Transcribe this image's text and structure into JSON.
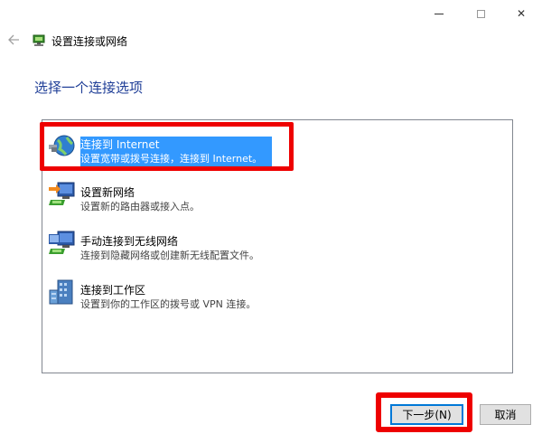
{
  "window": {
    "title": "设置连接或网络",
    "caption_close": "✕"
  },
  "heading": "选择一个连接选项",
  "options": [
    {
      "title": "连接到 Internet",
      "description": "设置宽带或拨号连接，连接到 Internet。",
      "icon": "globe-network-icon",
      "selected": true
    },
    {
      "title": "设置新网络",
      "description": "设置新的路由器或接入点。",
      "icon": "new-network-icon",
      "selected": false
    },
    {
      "title": "手动连接到无线网络",
      "description": "连接到隐藏网络或创建新无线配置文件。",
      "icon": "wireless-network-icon",
      "selected": false
    },
    {
      "title": "连接到工作区",
      "description": "设置到你的工作区的拨号或 VPN 连接。",
      "icon": "workplace-icon",
      "selected": false
    }
  ],
  "buttons": {
    "next": "下一步(N)",
    "cancel": "取消"
  },
  "colors": {
    "selection": "#3399ff",
    "heading": "#1f3e97",
    "annotation_red": "#ee0000"
  }
}
